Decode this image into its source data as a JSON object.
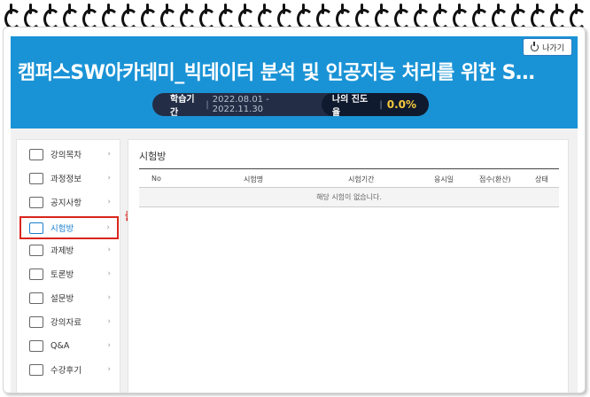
{
  "header": {
    "exit_label": "나가기",
    "title": "캠퍼스SW아카데미_빅데이터 분석 및 인공지능 처리를 위한 S…",
    "period_label": "학습기간",
    "period_dates": "2022.08.01 - 2022.11.30",
    "progress_label": "나의 진도율",
    "progress_value": "0.0%"
  },
  "sidebar": {
    "items": [
      {
        "label": "강의목차",
        "icon": "chat-list-icon"
      },
      {
        "label": "과정정보",
        "icon": "monitor-icon"
      },
      {
        "label": "공지사항",
        "icon": "board-icon"
      },
      {
        "label": "시험방",
        "icon": "edit-paper-icon",
        "active": true
      },
      {
        "label": "과제방",
        "icon": "document-icon"
      },
      {
        "label": "토론방",
        "icon": "discussion-icon"
      },
      {
        "label": "설문방",
        "icon": "survey-icon"
      },
      {
        "label": "강의자료",
        "icon": "books-icon"
      },
      {
        "label": "Q&A",
        "icon": "qa-icon"
      },
      {
        "label": "수강후기",
        "icon": "review-icon"
      }
    ]
  },
  "annotation": {
    "click_label": "클릭"
  },
  "main": {
    "title": "시험방",
    "columns": [
      "No",
      "시험명",
      "시험기간",
      "응시일",
      "점수(환산)",
      "상태"
    ],
    "empty_message": "해당 시험이 없습니다."
  },
  "colors": {
    "header_bg": "#1a93d6",
    "highlight": "#d9251c",
    "progress_value": "#f7c93b"
  }
}
